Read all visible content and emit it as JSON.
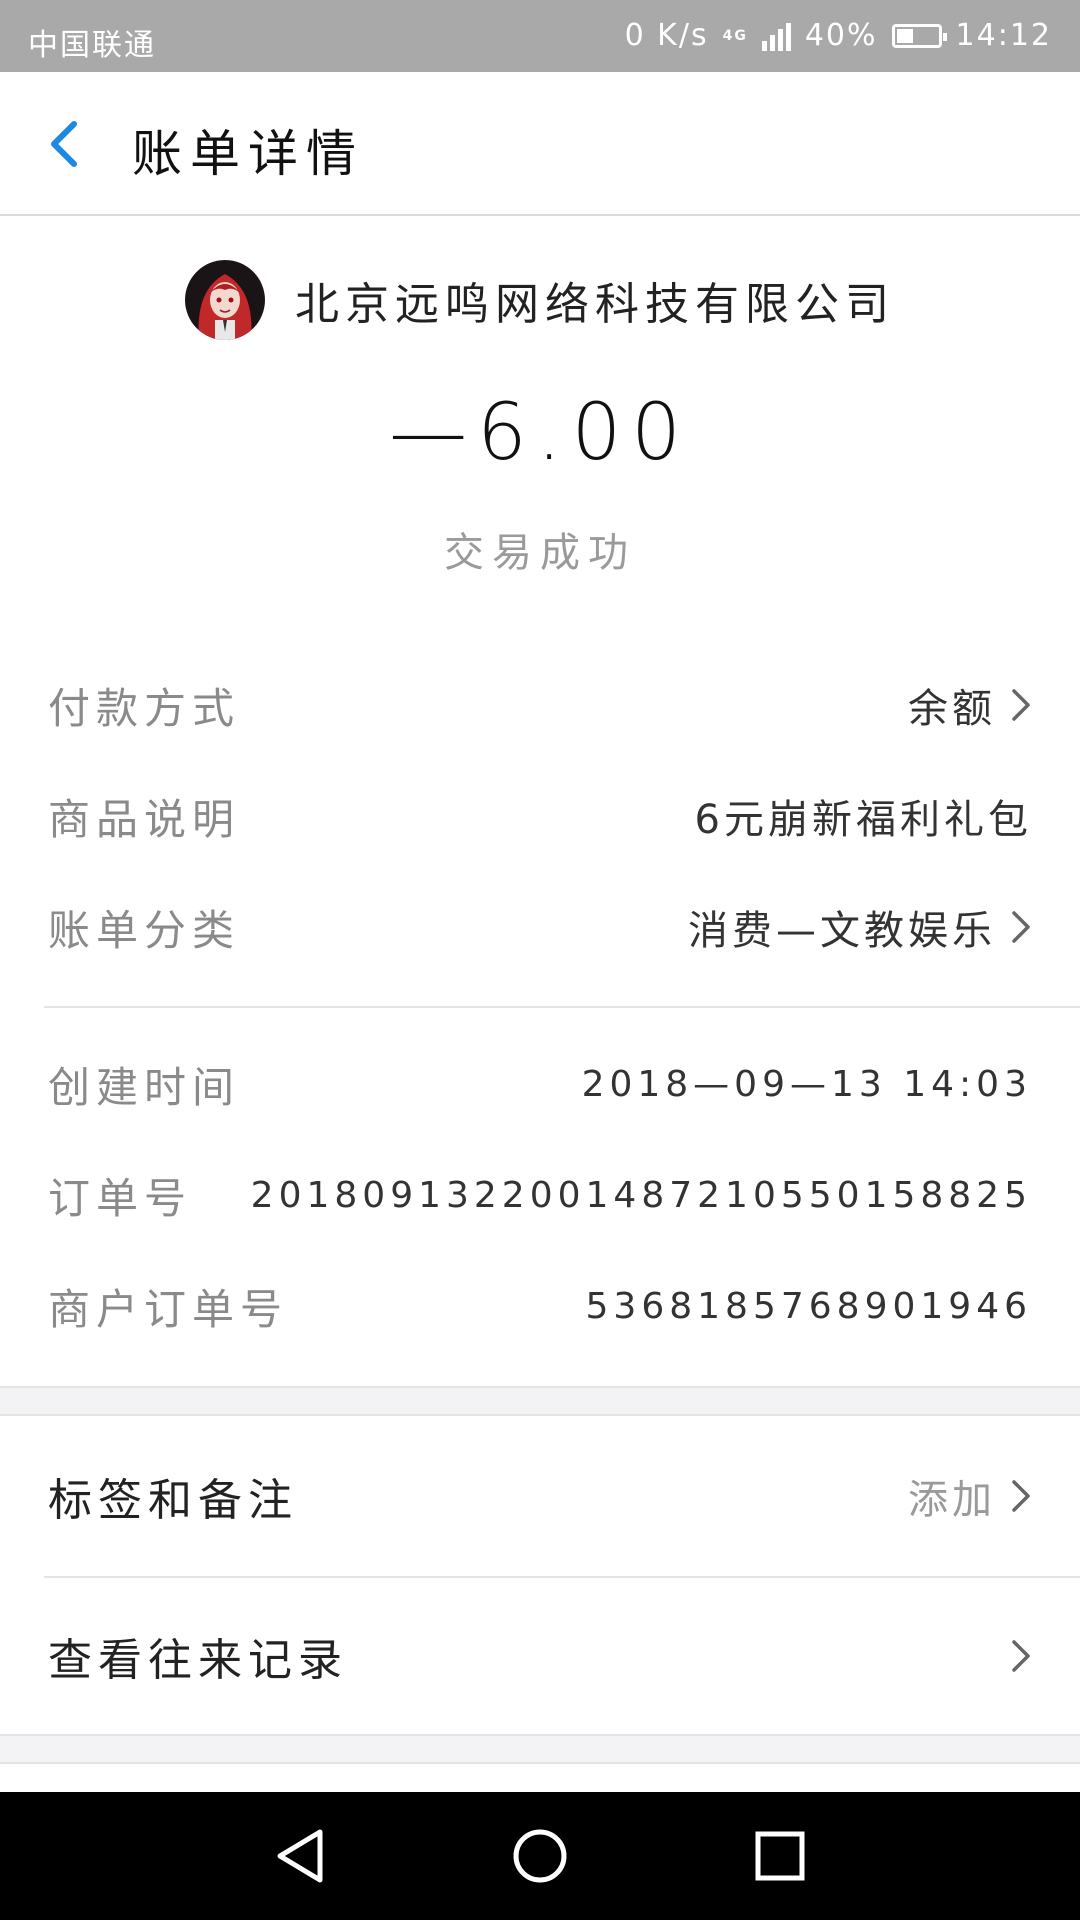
{
  "status_bar": {
    "carrier": "中国联通",
    "speed": "0 K/s",
    "network": "4G",
    "battery": "40%",
    "time": "14:12"
  },
  "header": {
    "title": "账单详情",
    "back_icon": "chevron-left-icon"
  },
  "merchant": {
    "name": "北京远鸣网络科技有限公司"
  },
  "amount": "—6.00",
  "transaction_status": "交易成功",
  "details_1": [
    {
      "label": "付款方式",
      "value": "余额"
    },
    {
      "label": "商品说明",
      "value": "6元崩新福利礼包"
    },
    {
      "label": "账单分类",
      "value": "消费—文教娱乐"
    }
  ],
  "details_2": [
    {
      "label": "创建时间",
      "value": "2018—09—13  14:03"
    },
    {
      "label": "订单号",
      "value": "2018091322001487210550158825"
    },
    {
      "label": "商户订单号",
      "value": "5368185768901946"
    }
  ],
  "actions": [
    {
      "label": "标签和备注",
      "value": "添加"
    },
    {
      "label": "查看往来记录",
      "value": ""
    }
  ],
  "colors": {
    "accent": "#1e88e5",
    "status_bar_bg": "#a9a9a9",
    "muted_text": "#8a8a8a",
    "section_gap": "#f3f3f6"
  }
}
